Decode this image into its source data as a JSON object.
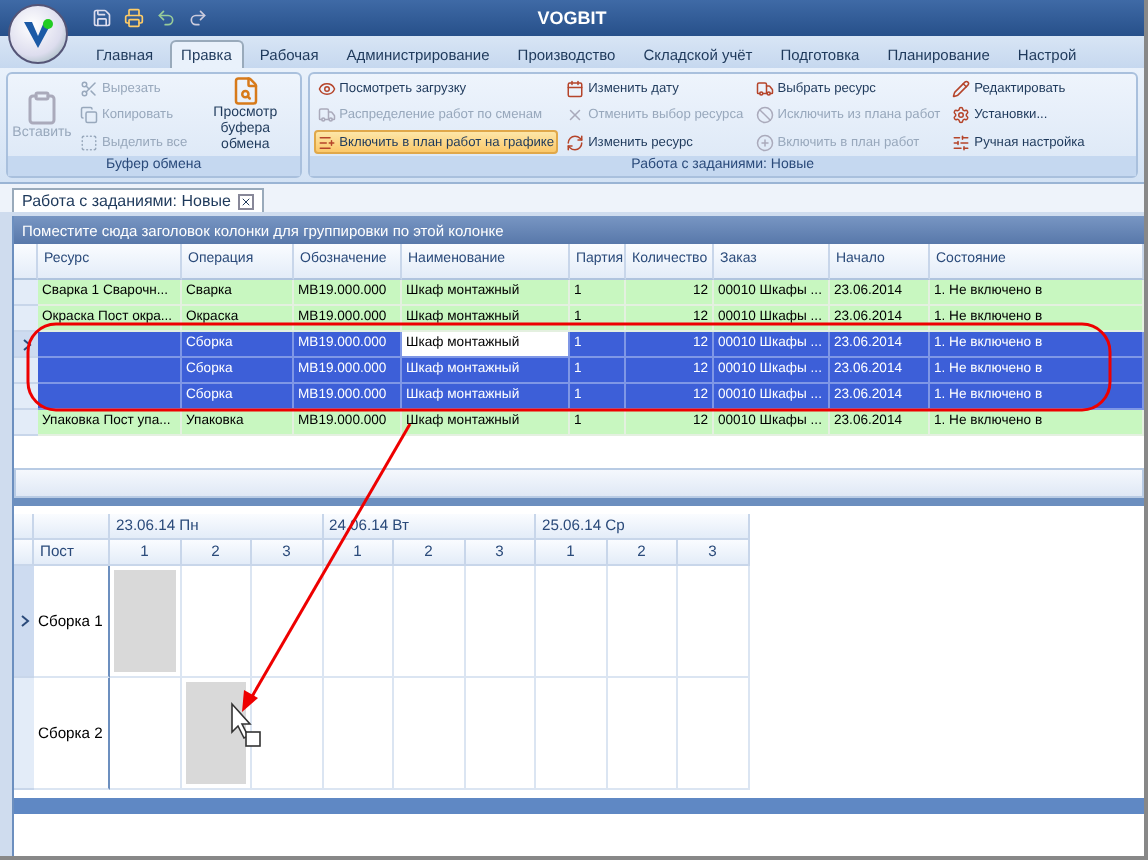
{
  "window": {
    "title": "VOGBIT"
  },
  "ribbon_tabs": [
    {
      "label": "Главная",
      "selected": false
    },
    {
      "label": "Правка",
      "selected": true
    },
    {
      "label": "Рабочая",
      "selected": false
    },
    {
      "label": "Администрирование",
      "selected": false
    },
    {
      "label": "Производство",
      "selected": false
    },
    {
      "label": "Складской учёт",
      "selected": false
    },
    {
      "label": "Подготовка",
      "selected": false
    },
    {
      "label": "Планирование",
      "selected": false
    },
    {
      "label": "Настрой",
      "selected": false
    }
  ],
  "clipboard_group": {
    "title": "Буфер обмена",
    "paste": {
      "label": "Вставить",
      "disabled": true
    },
    "small": [
      {
        "label": "Вырезать",
        "disabled": true
      },
      {
        "label": "Копировать",
        "disabled": true
      },
      {
        "label": "Выделить все",
        "disabled": true
      }
    ],
    "preview": {
      "label": "Просмотр буфера обмена",
      "disabled": false
    }
  },
  "tasks_group": {
    "title": "Работа с заданиями: Новые",
    "columns": [
      [
        {
          "label": "Посмотреть загрузку",
          "disabled": false,
          "highlighted": false
        },
        {
          "label": "Распределение работ по сменам",
          "disabled": true,
          "highlighted": false
        },
        {
          "label": "Включить в план работ на графике",
          "disabled": false,
          "highlighted": true
        }
      ],
      [
        {
          "label": "Изменить дату",
          "disabled": false,
          "highlighted": false
        },
        {
          "label": "Отменить выбор ресурса",
          "disabled": true,
          "highlighted": false
        },
        {
          "label": "Изменить ресурс",
          "disabled": false,
          "highlighted": false
        }
      ],
      [
        {
          "label": "Выбрать ресурс",
          "disabled": false,
          "highlighted": false
        },
        {
          "label": "Исключить из плана работ",
          "disabled": true,
          "highlighted": false
        },
        {
          "label": "Включить в план работ",
          "disabled": true,
          "highlighted": false
        }
      ],
      [
        {
          "label": "Редактировать",
          "disabled": false,
          "highlighted": false
        },
        {
          "label": "Установки...",
          "disabled": false,
          "highlighted": false
        },
        {
          "label": "Ручная настройка",
          "disabled": false,
          "highlighted": false
        }
      ]
    ]
  },
  "document_tab": {
    "label": "Работа с заданиями: Новые"
  },
  "group_panel": {
    "hint": "Поместите сюда заголовок колонки для группировки по этой колонке"
  },
  "table": {
    "columns": [
      "Ресурс",
      "Операция",
      "Обозначение",
      "Наименование",
      "Партия",
      "Количество",
      "Заказ",
      "Начало",
      "Состояние"
    ],
    "rows": [
      {
        "selected": false,
        "current": false,
        "editing": false,
        "cells": [
          "Сварка 1 Сварочн...",
          "Сварка",
          "МВ19.000.000",
          "Шкаф монтажный",
          "1",
          "12",
          "00010 Шкафы ...",
          "23.06.2014",
          "1. Не включено в"
        ]
      },
      {
        "selected": false,
        "current": false,
        "editing": false,
        "cells": [
          "Окраска Пост окра...",
          "Окраска",
          "МВ19.000.000",
          "Шкаф монтажный",
          "1",
          "12",
          "00010 Шкафы ...",
          "23.06.2014",
          "1. Не включено в"
        ]
      },
      {
        "selected": true,
        "current": true,
        "editing": true,
        "cells": [
          "",
          "Сборка",
          "МВ19.000.000",
          "Шкаф монтажный",
          "1",
          "12",
          "00010 Шкафы ...",
          "23.06.2014",
          "1. Не включено в"
        ]
      },
      {
        "selected": true,
        "current": false,
        "editing": false,
        "cells": [
          "",
          "Сборка",
          "МВ19.000.000",
          "Шкаф монтажный",
          "1",
          "12",
          "00010 Шкафы ...",
          "23.06.2014",
          "1. Не включено в"
        ]
      },
      {
        "selected": true,
        "current": false,
        "editing": false,
        "cells": [
          "",
          "Сборка",
          "МВ19.000.000",
          "Шкаф монтажный",
          "1",
          "12",
          "00010 Шкафы ...",
          "23.06.2014",
          "1. Не включено в"
        ]
      },
      {
        "selected": false,
        "current": false,
        "editing": false,
        "cells": [
          "Упаковка Пост упа...",
          "Упаковка",
          "МВ19.000.000",
          "Шкаф монтажный",
          "1",
          "12",
          "00010 Шкафы ...",
          "23.06.2014",
          "1. Не включено в"
        ]
      }
    ]
  },
  "schedule": {
    "post_header": "Пост",
    "days": [
      {
        "label": "23.06.14 Пн",
        "shifts": [
          "1",
          "2",
          "3"
        ]
      },
      {
        "label": "24.06.14 Вт",
        "shifts": [
          "1",
          "2",
          "3"
        ]
      },
      {
        "label": "25.06.14 Ср",
        "shifts": [
          "1",
          "2",
          "3"
        ]
      }
    ],
    "rows": [
      {
        "name": "Сборка 1",
        "current": true,
        "cells": [
          true,
          false,
          false,
          false,
          false,
          false,
          false,
          false,
          false
        ]
      },
      {
        "name": "Сборка 2",
        "current": false,
        "cells": [
          false,
          true,
          false,
          false,
          false,
          false,
          false,
          false,
          false
        ]
      }
    ]
  }
}
